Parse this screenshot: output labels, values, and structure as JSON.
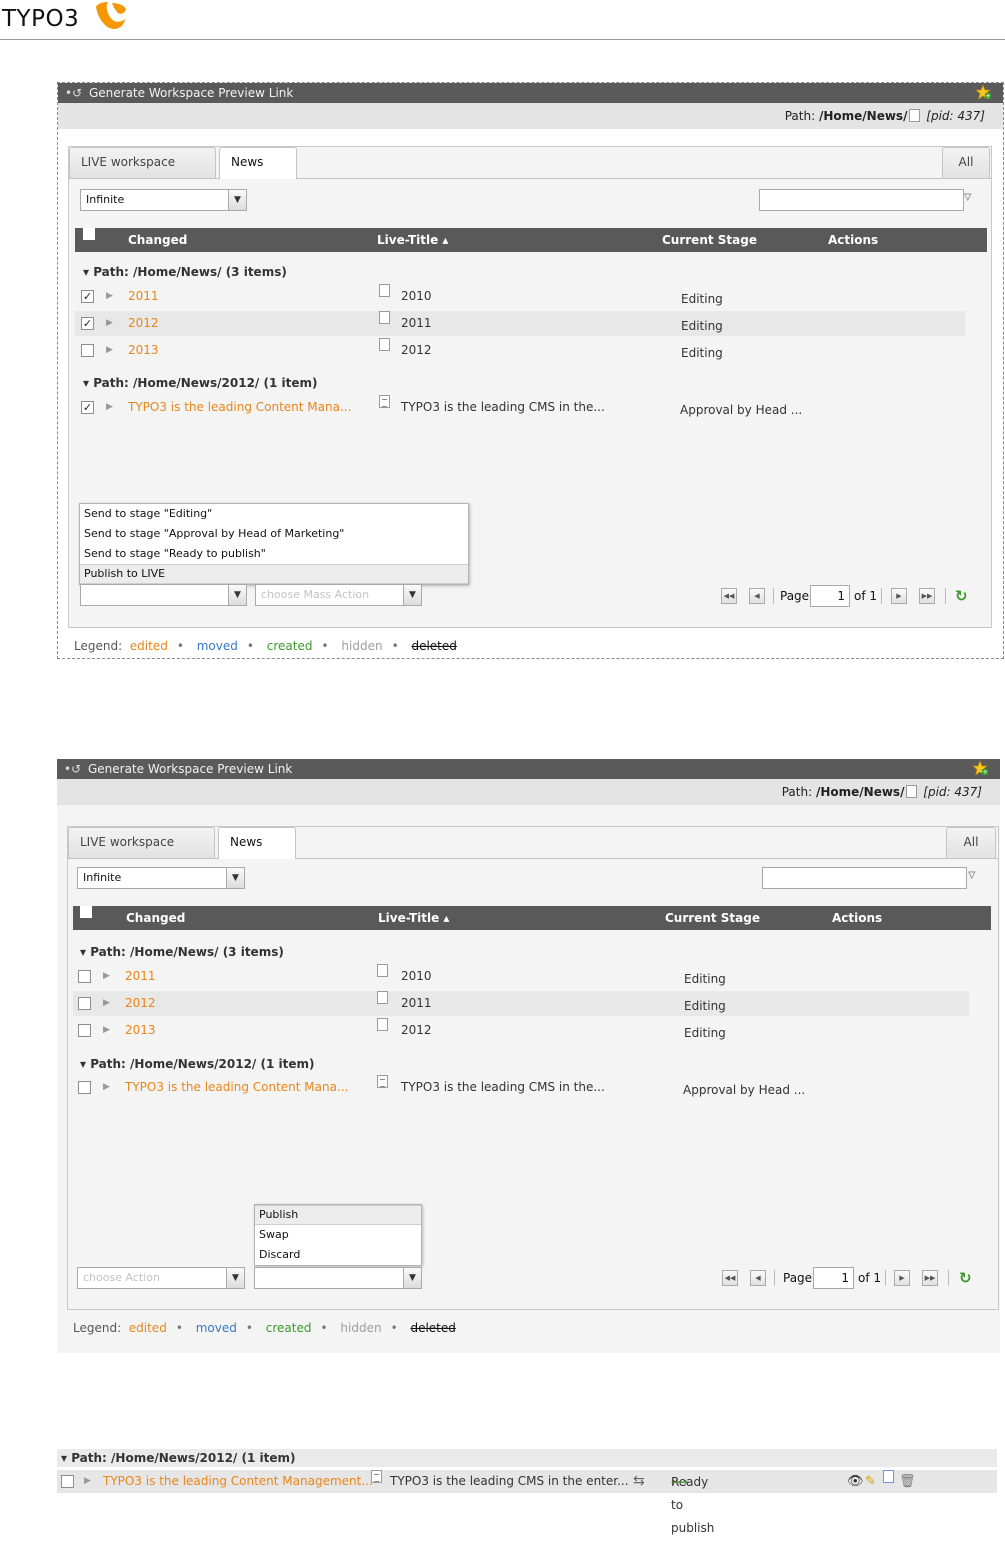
{
  "logo": {
    "text": "TYPO3"
  },
  "panel": {
    "title": "Generate Workspace Preview Link",
    "path_label": "Path:",
    "path_value": "/Home/News/",
    "pid": "[pid: 437]",
    "tabs": [
      "LIVE workspace",
      "News"
    ],
    "tab_all": "All",
    "depth_select": "Infinite",
    "columns": {
      "changed": "Changed",
      "live_title": "Live-Title ▴",
      "current_stage": "Current Stage",
      "actions": "Actions"
    },
    "groups": [
      {
        "label": "▾   Path: /Home/News/ (3 items)"
      },
      {
        "label": "▾   Path: /Home/News/2012/ (1 item)"
      }
    ],
    "rows": [
      {
        "changed": "2011",
        "title": "2010",
        "stage": "Editing"
      },
      {
        "changed": "2012",
        "title": "2011",
        "stage": "Editing"
      },
      {
        "changed": "2013",
        "title": "2012",
        "stage": "Editing"
      },
      {
        "changed": "TYPO3 is the leading Content Mana...",
        "title": "TYPO3 is the leading CMS in the...",
        "stage": "Approval by Head ..."
      }
    ],
    "pager": {
      "page_label": "Page",
      "page": "1",
      "of": "of 1"
    },
    "legend": {
      "label": "Legend:",
      "edited": "edited",
      "moved": "moved",
      "created": "created",
      "hidden": "hidden",
      "deleted": "deleted"
    }
  },
  "shot1": {
    "checked": [
      true,
      true,
      false,
      true
    ],
    "stage_menu": [
      "Send to stage \"Editing\"",
      "Send to stage \"Approval by Head of Marketing\"",
      "Send to stage \"Ready to publish\"",
      "Publish to LIVE"
    ],
    "mass_action_placeholder": "choose Mass Action"
  },
  "shot2": {
    "checked": [
      false,
      false,
      false,
      false
    ],
    "action_placeholder": "choose Action",
    "mass_menu": [
      "Publish",
      "Swap",
      "Discard"
    ]
  },
  "strip": {
    "group": "▾   Path: /Home/News/2012/ (1 item)",
    "changed": "TYPO3 is the leading Content Management...",
    "title": "TYPO3 is the leading CMS in the enter...",
    "stage": "Ready to publish"
  }
}
